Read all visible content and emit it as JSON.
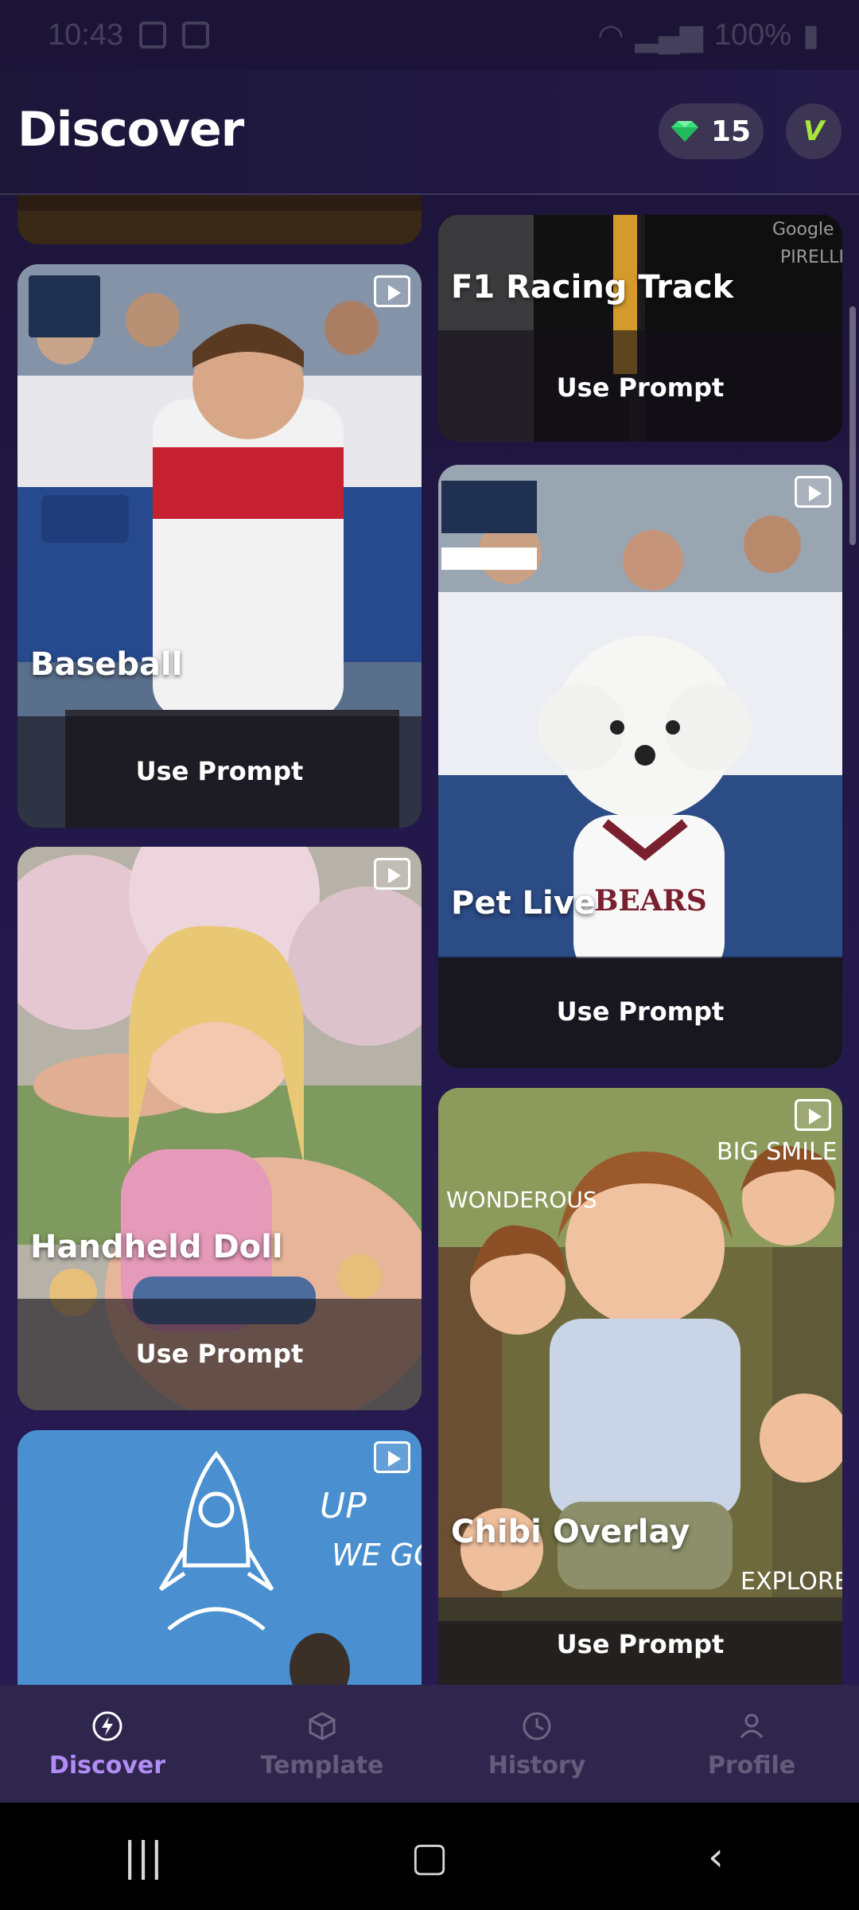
{
  "status_bar": {
    "time": "10:43",
    "battery": "100%"
  },
  "header": {
    "title": "Discover",
    "gem_count": "15",
    "vip_label": "V"
  },
  "cards": [
    {
      "title": "",
      "use_prompt": ""
    },
    {
      "title": "Baseball",
      "use_prompt": "Use Prompt"
    },
    {
      "title": "Handheld Doll",
      "use_prompt": "Use Prompt"
    },
    {
      "title": "",
      "use_prompt": ""
    },
    {
      "title": "F1 Racing Track",
      "use_prompt": "Use Prompt"
    },
    {
      "title": "Pet Live",
      "use_prompt": "Use Prompt"
    },
    {
      "title": "Chibi Overlay",
      "use_prompt": "Use Prompt"
    }
  ],
  "bottom_nav": {
    "items": [
      {
        "label": "Discover",
        "icon": "bolt-icon",
        "active": true
      },
      {
        "label": "Template",
        "icon": "cube-icon",
        "active": false
      },
      {
        "label": "History",
        "icon": "clock-icon",
        "active": false
      },
      {
        "label": "Profile",
        "icon": "person-icon",
        "active": false
      }
    ]
  },
  "colors": {
    "accent": "#b18cf5",
    "gem": "#38e07a",
    "vip": "#a8e63c"
  }
}
